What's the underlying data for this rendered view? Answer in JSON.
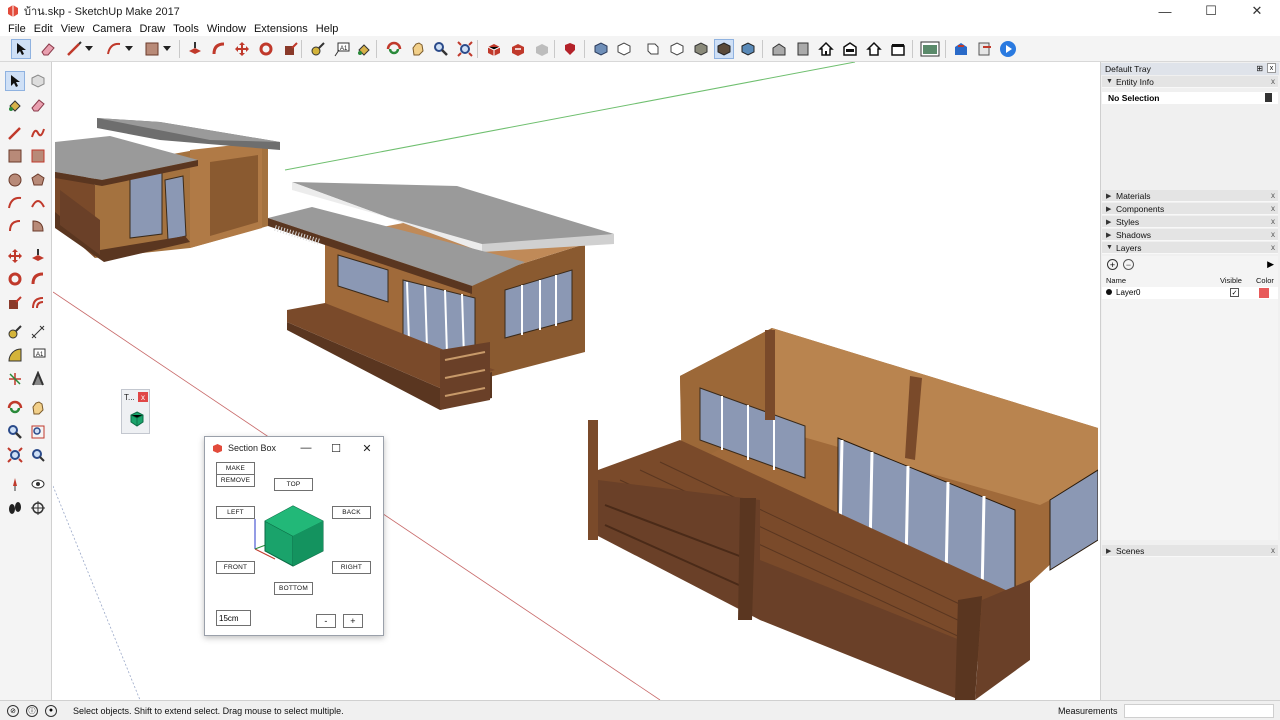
{
  "window": {
    "title": "บ้าน.skp - SketchUp Make 2017",
    "minimize": "—",
    "maximize": "☐",
    "close": "✕"
  },
  "menu": [
    "File",
    "Edit",
    "View",
    "Camera",
    "Draw",
    "Tools",
    "Window",
    "Extensions",
    "Help"
  ],
  "mini_toolbar": {
    "title": "T...",
    "close": "x"
  },
  "section_box": {
    "title": "Section Box",
    "make": "MAKE",
    "remove": "REMOVE",
    "top": "TOP",
    "left": "LEFT",
    "back": "BACK",
    "front": "FRONT",
    "right": "RIGHT",
    "bottom": "BOTTOM",
    "offset_value": "15cm",
    "minus": "-",
    "plus": "+"
  },
  "tray": {
    "title": "Default Tray",
    "entity_info": "Entity Info",
    "selection": "No Selection",
    "materials": "Materials",
    "components": "Components",
    "styles": "Styles",
    "shadows": "Shadows",
    "layers": "Layers",
    "scenes": "Scenes",
    "col_name": "Name",
    "col_visible": "Visible",
    "col_color": "Color",
    "layer_name": "Layer0",
    "layer_color": "#e85a5a"
  },
  "status": {
    "hint": "Select objects. Shift to extend select. Drag mouse to select multiple.",
    "measurements_label": "Measurements",
    "measurements_value": ""
  },
  "colors": {
    "accent_green": "#1aa36b",
    "wood": "#8a5a36",
    "wood_dark": "#5a3620",
    "roof": "#8e8e8e",
    "glass": "#8b98b4"
  }
}
